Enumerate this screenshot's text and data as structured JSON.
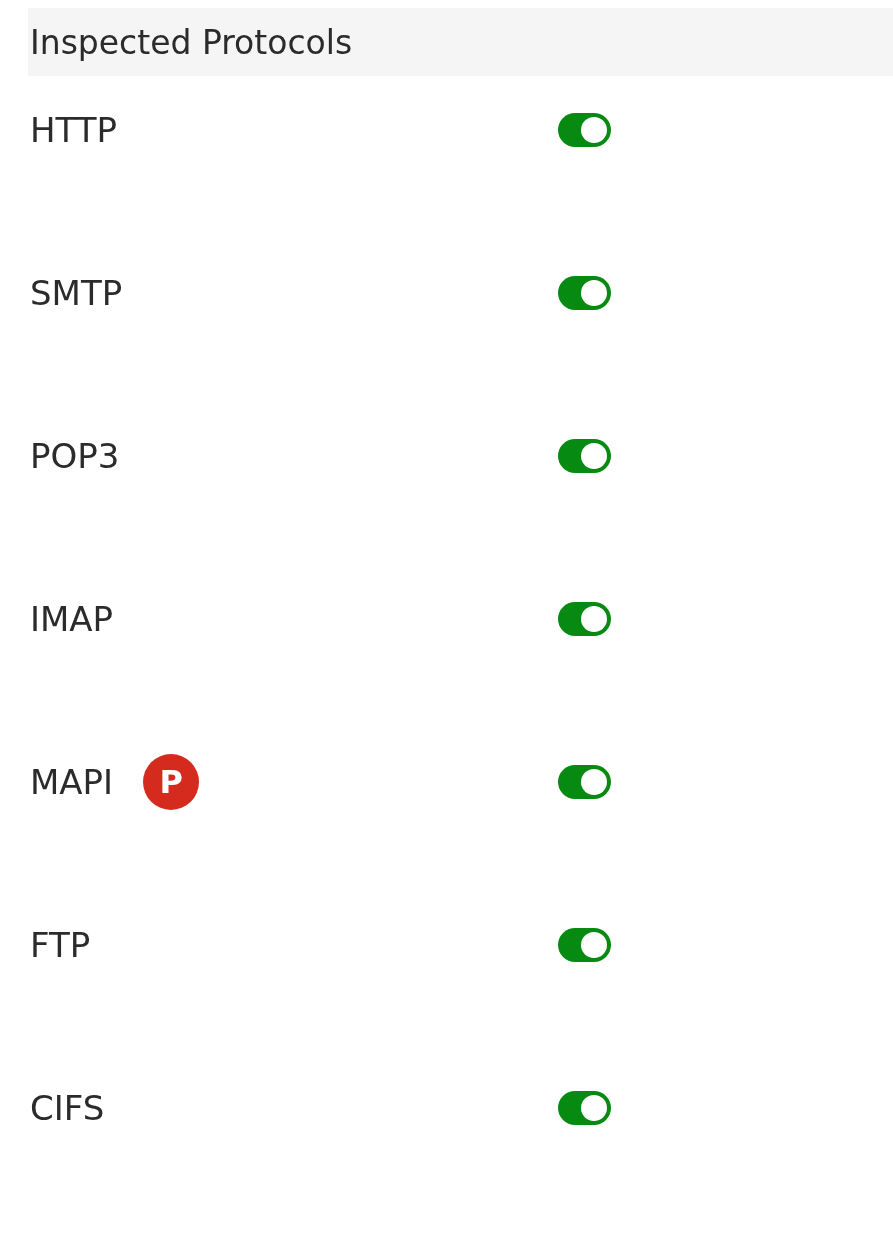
{
  "section": {
    "title": "Inspected Protocols"
  },
  "protocols": [
    {
      "name": "HTTP",
      "on": true
    },
    {
      "name": "SMTP",
      "on": true
    },
    {
      "name": "POP3",
      "on": true
    },
    {
      "name": "IMAP",
      "on": true
    },
    {
      "name": "MAPI",
      "on": true,
      "badge": "P"
    },
    {
      "name": "FTP",
      "on": true
    },
    {
      "name": "CIFS",
      "on": true
    }
  ]
}
